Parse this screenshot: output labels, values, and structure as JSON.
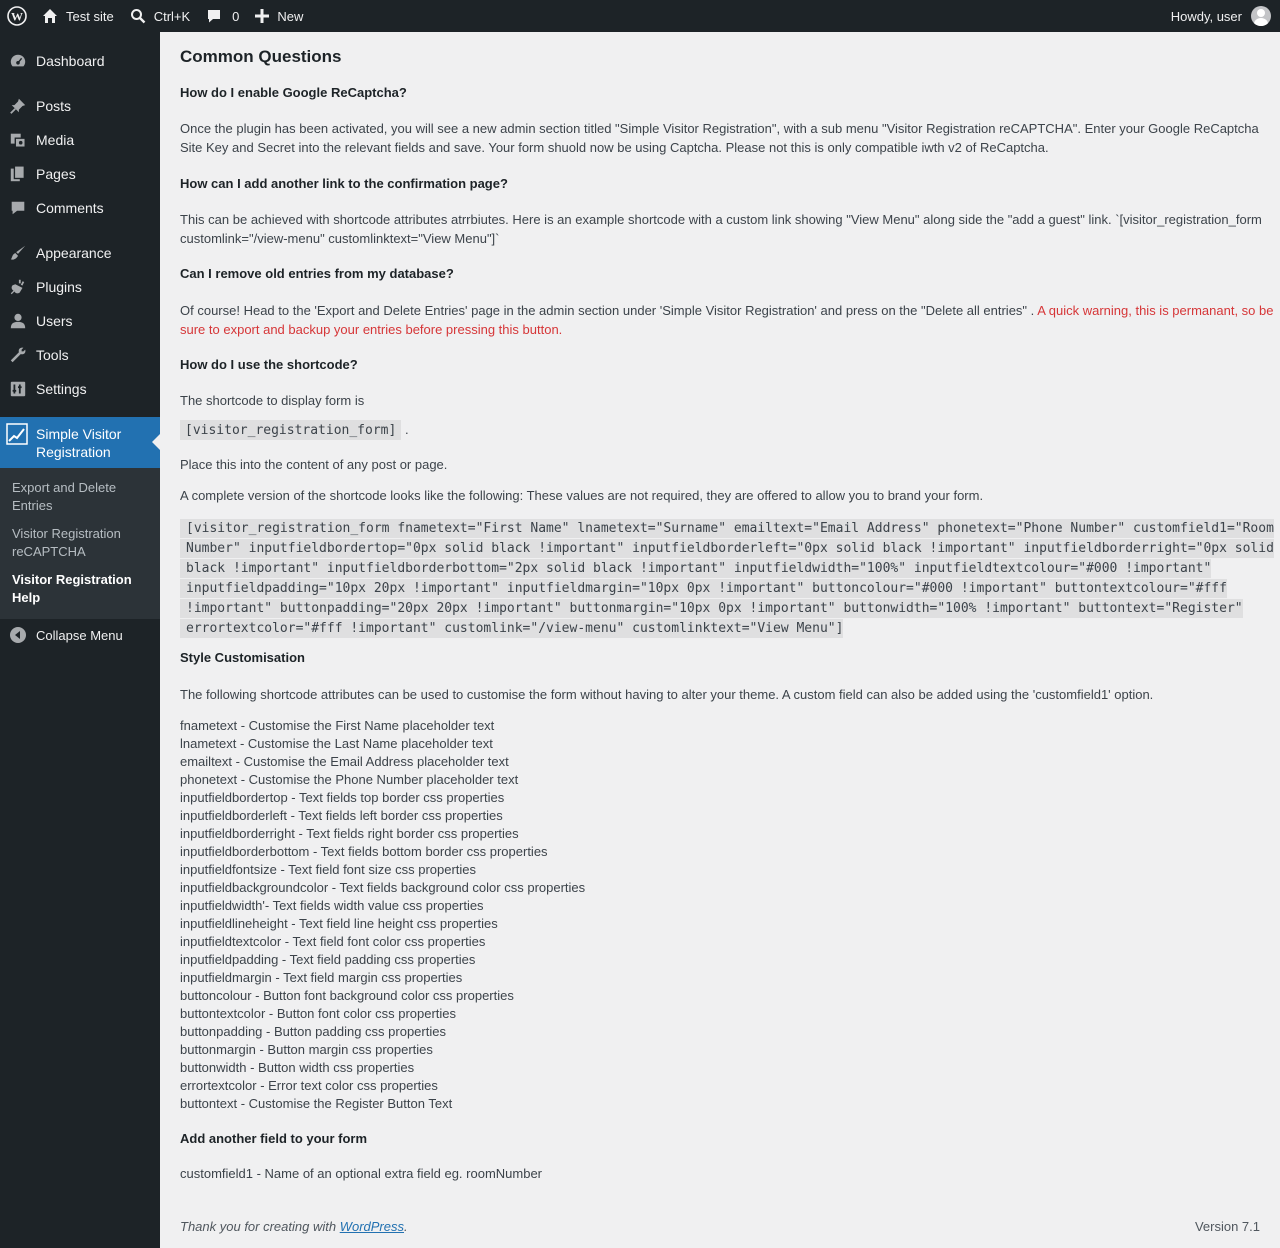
{
  "adminbar": {
    "site_name": "Test site",
    "search_shortcut": "Ctrl+K",
    "comments_count": "0",
    "new_label": "New",
    "howdy": "Howdy, user"
  },
  "sidebar": {
    "items": [
      {
        "label": "Dashboard",
        "icon": "dashboard-icon"
      },
      {
        "label": "Posts",
        "icon": "pin-icon"
      },
      {
        "label": "Media",
        "icon": "media-icon"
      },
      {
        "label": "Pages",
        "icon": "pages-icon"
      },
      {
        "label": "Comments",
        "icon": "comment-icon"
      },
      {
        "label": "Appearance",
        "icon": "brush-icon"
      },
      {
        "label": "Plugins",
        "icon": "plugin-icon"
      },
      {
        "label": "Users",
        "icon": "user-icon"
      },
      {
        "label": "Tools",
        "icon": "wrench-icon"
      },
      {
        "label": "Settings",
        "icon": "settings-icon"
      }
    ],
    "current": {
      "label": "Simple Visitor Registration",
      "icon": "chart-icon"
    },
    "submenu": [
      "Export and Delete Entries",
      "Visitor Registration reCAPTCHA",
      "Visitor Registration Help"
    ],
    "collapse": "Collapse Menu"
  },
  "main": {
    "title": "Common Questions",
    "q1": "How do I enable Google ReCaptcha?",
    "a1": "Once the plugin has been activated, you will see a new admin section titled \"Simple Visitor Registration\", with a sub menu \"Visitor Registration reCAPTCHA\". Enter your Google ReCaptcha Site Key and Secret into the relevant fields and save. Your form shuold now be using Captcha. Please not this is only compatible iwth v2 of ReCaptcha.",
    "q2": "How can I add another link to the confirmation page?",
    "a2": "This can be achieved with shortcode attributes atrrbiutes. Here is an example shortcode with a custom link showing \"View Menu\" along side the \"add a guest\" link. `[visitor_registration_form customlink=\"/view-menu\" customlinktext=\"View Menu\"]`",
    "q3": "Can I remove old entries from my database?",
    "a3": "Of course! Head to the 'Export and Delete Entries' page in the admin section under 'Simple Visitor Registration' and press on the \"Delete all entries\" .",
    "a3_warning": "A quick warning, this is permanant, so be sure to export and backup your entries before pressing this button.",
    "q4": "How do I use the shortcode?",
    "a4": "The shortcode to display form is",
    "shortcode": "[visitor_registration_form]",
    "shortcode_suffix": ".",
    "a4b": "Place this into the content of any post or page.",
    "a4c": "A complete version of the shortcode looks like the following: These values are not required, they are offered to allow you to brand your form.",
    "full_shortcode": "[visitor_registration_form fnametext=\"First Name\" lnametext=\"Surname\" emailtext=\"Email Address\" phonetext=\"Phone Number\" customfield1=\"Room Number\" inputfieldbordertop=\"0px solid black !important\" inputfieldborderleft=\"0px solid black !important\" inputfieldborderright=\"0px solid black !important\" inputfieldborderbottom=\"2px solid black !important\" inputfieldwidth=\"100%\" inputfieldtextcolour=\"#000 !important\" inputfieldpadding=\"10px 20px !important\" inputfieldmargin=\"10px 0px !important\" buttoncolour=\"#000 !important\" buttontextcolour=\"#fff !important\" buttonpadding=\"20px 20px !important\" buttonmargin=\"10px 0px !important\" buttonwidth=\"100% !important\" buttontext=\"Register\" errortextcolor=\"#fff !important\" customlink=\"/view-menu\" customlinktext=\"View Menu\"]",
    "q5": "Style Customisation",
    "a5": "The following shortcode attributes can be used to customise the form without having to alter your theme. A custom field can also be added using the 'customfield1' option.",
    "attributes": [
      "fnametext - Customise the First Name placeholder text",
      "lnametext - Customise the Last Name placeholder text",
      "emailtext - Customise the Email Address placeholder text",
      "phonetext - Customise the Phone Number placeholder text",
      "inputfieldbordertop - Text fields top border css properties",
      "inputfieldborderleft - Text fields left border css properties",
      "inputfieldborderright - Text fields right border css properties",
      "inputfieldborderbottom - Text fields bottom border css properties",
      "inputfieldfontsize - Text field font size css properties",
      "inputfieldbackgroundcolor - Text fields background color css properties",
      "inputfieldwidth'- Text fields width value css properties",
      "inputfieldlineheight - Text field line height css properties",
      "inputfieldtextcolor - Text field font color css properties",
      "inputfieldpadding - Text field padding css properties",
      "inputfieldmargin - Text field margin css properties",
      "buttoncolour - Button font background color css properties",
      "buttontextcolor - Button font color css properties",
      "buttonpadding - Button padding css properties",
      "buttonmargin - Button margin css properties",
      "buttonwidth - Button width css properties",
      "errortextcolor - Error text color css properties",
      "buttontext - Customise the Register Button Text"
    ],
    "q6": "Add another field to your form",
    "a6": "customfield1 - Name of an optional extra field eg. roomNumber"
  },
  "footer": {
    "thanks_prefix": "Thank you for creating with ",
    "thanks_link": "WordPress",
    "thanks_suffix": ".",
    "version": "Version 7.1"
  },
  "colors": {
    "adminbar_bg": "#1d2327",
    "accent": "#2271b1",
    "warning": "#d63638",
    "page_bg": "#f0f0f1"
  }
}
